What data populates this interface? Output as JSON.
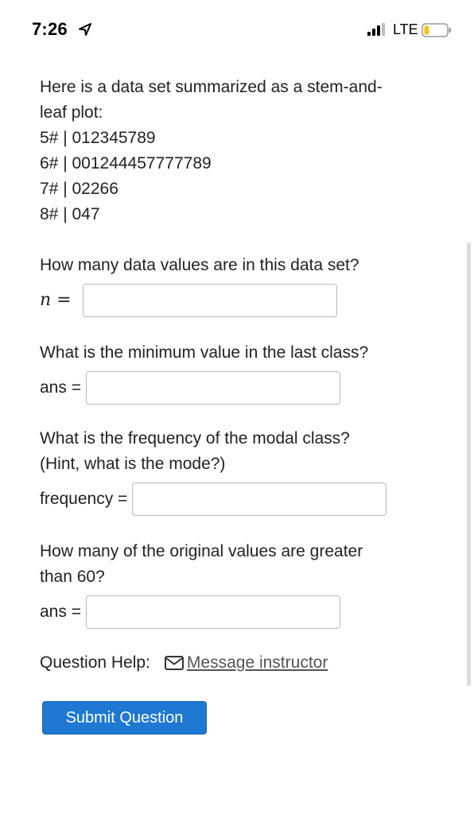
{
  "status_bar": {
    "time": "7:26",
    "network": "LTE",
    "icons": [
      "location-arrow-icon",
      "signal-bars-icon",
      "battery-icon"
    ]
  },
  "intro": {
    "lines": [
      "Here is a data set summarized as a stem-and-",
      "leaf plot:"
    ]
  },
  "stem_leaf": [
    {
      "stem": "5#",
      "leaves": "012345789"
    },
    {
      "stem": "6#",
      "leaves": "001244457777789"
    },
    {
      "stem": "7#",
      "leaves": "02266"
    },
    {
      "stem": "8#",
      "leaves": "047"
    }
  ],
  "questions": [
    {
      "lines": [
        "How many data values are in this data set?"
      ],
      "label": "n =",
      "value": ""
    },
    {
      "lines": [
        "What is the minimum value in the last class?"
      ],
      "label": "ans =",
      "value": ""
    },
    {
      "lines": [
        "What is the frequency of the modal class?",
        "(Hint, what is the mode?)"
      ],
      "label": "frequency =",
      "value": ""
    },
    {
      "lines": [
        "How many of the original values are greater",
        "than 60?"
      ],
      "label": "ans =",
      "value": ""
    }
  ],
  "help": {
    "label": "Question Help:",
    "link": "Message instructor"
  },
  "submit_label": "Submit Question",
  "colors": {
    "accent": "#1f78d1",
    "battery": "#f5c518"
  }
}
